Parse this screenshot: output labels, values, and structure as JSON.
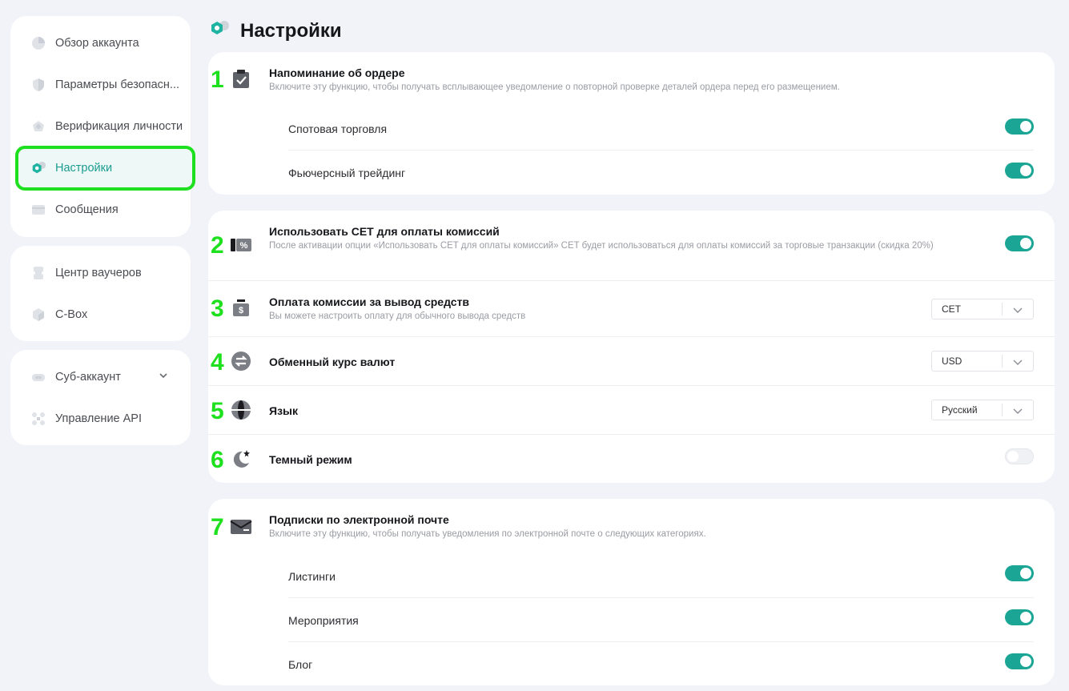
{
  "sidebar": {
    "items": [
      {
        "label": "Обзор аккаунта",
        "icon": "pie-chart-icon"
      },
      {
        "label": "Параметры безопасн...",
        "icon": "shield-icon"
      },
      {
        "label": "Верификация личности",
        "icon": "id-badge-icon"
      },
      {
        "label": "Настройки",
        "icon": "settings-hex-icon",
        "active": true
      },
      {
        "label": "Сообщения",
        "icon": "message-icon"
      },
      {
        "label": "Центр ваучеров",
        "icon": "voucher-icon"
      },
      {
        "label": "C-Box",
        "icon": "box-icon"
      },
      {
        "label": "Суб-аккаунт",
        "icon": "sub-account-icon"
      },
      {
        "label": "Управление API",
        "icon": "api-icon"
      }
    ]
  },
  "page": {
    "title": "Настройки"
  },
  "order_reminder": {
    "number": "1",
    "title": "Напоминание об ордере",
    "description": "Включите эту функцию, чтобы получать всплывающее уведомление о повторной проверке деталей ордера перед его размещением.",
    "items": [
      {
        "label": "Спотовая торговля",
        "enabled": true
      },
      {
        "label": "Фьючерсный трейдинг",
        "enabled": true
      }
    ]
  },
  "cet_fee": {
    "number": "2",
    "title": "Использовать CET для оплаты комиссий",
    "description": "После активации опции «Использовать CET для оплаты комиссий» CET будет использоваться для оплаты комиссий за торговые транзакции (скидка 20%)",
    "enabled": true
  },
  "withdraw_fee": {
    "number": "3",
    "title": "Оплата комиссии за вывод средств",
    "description": "Вы можете настроить оплату для обычного вывода средств",
    "value": "CET"
  },
  "exchange_rate": {
    "number": "4",
    "title": "Обменный курс валют",
    "value": "USD"
  },
  "language": {
    "number": "5",
    "title": "Язык",
    "value": "Русский"
  },
  "dark_mode": {
    "number": "6",
    "title": "Темный режим",
    "enabled": false
  },
  "email_subs": {
    "number": "7",
    "title": "Подписки по электронной почте",
    "description": "Включите эту функцию, чтобы получать уведомления по электронной почте о следующих категориях.",
    "items": [
      {
        "label": "Листинги",
        "enabled": true
      },
      {
        "label": "Мероприятия",
        "enabled": true
      },
      {
        "label": "Блог",
        "enabled": true
      }
    ]
  },
  "colors": {
    "accent": "#1aa595",
    "highlight": "#1ee01e",
    "active_text": "#1b9c90"
  }
}
